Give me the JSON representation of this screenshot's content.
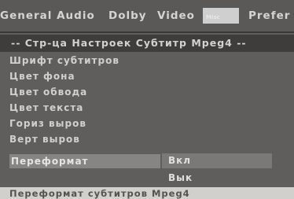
{
  "tabs": [
    {
      "label": "General Audio"
    },
    {
      "label": "Dolby"
    },
    {
      "label": "Video"
    },
    {
      "label": "Misc"
    },
    {
      "label": "Prefer"
    }
  ],
  "page_title": "-- Стр-ца Настроек Субтитр Mpeg4 --",
  "menu": {
    "items": [
      {
        "label": "Шрифт субтитров"
      },
      {
        "label": "Цвет фона"
      },
      {
        "label": "Цвет обвода"
      },
      {
        "label": "Цвет текста"
      },
      {
        "label": "Гориз выров"
      },
      {
        "label": "Верт выров"
      },
      {
        "label": "Переформат"
      }
    ],
    "selected_index": 6,
    "options": [
      {
        "label": "Вкл"
      },
      {
        "label": "Вык"
      }
    ]
  },
  "status_text": "Переформат субтитров Mpeg4",
  "colors": {
    "background": "#5f5e5c",
    "title_bar": "#3e3d3b",
    "selection": "#868583",
    "status_bar": "#d2d0cd"
  }
}
